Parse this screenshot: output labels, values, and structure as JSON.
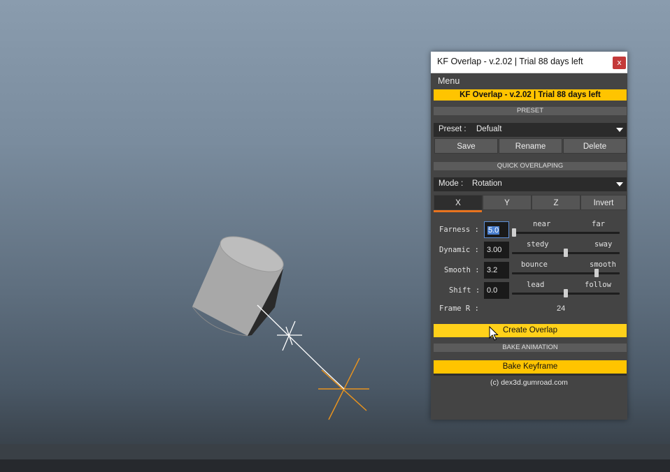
{
  "window": {
    "title": "KF Overlap  -  v.2.02  |  Trial 88 days left",
    "close_label": "x",
    "menu_label": "Menu",
    "banner": "KF Overlap  -  v.2.02  |  Trial 88 days left"
  },
  "preset": {
    "section_label": "PRESET",
    "label": "Preset :",
    "value": "Defualt",
    "buttons": [
      "Save",
      "Rename",
      "Delete"
    ]
  },
  "quick": {
    "section_label": "QUICK OVERLAPING",
    "mode_label": "Mode :",
    "mode_value": "Rotation",
    "tabs": [
      "X",
      "Y",
      "Z",
      "Invert"
    ],
    "selected_tab": "X"
  },
  "params": [
    {
      "label": "Farness :",
      "value": "5.0",
      "left": "near",
      "right": "far",
      "slider": 0.0
    },
    {
      "label": "Dynamic :",
      "value": "3.00",
      "left": "stedy",
      "right": "sway",
      "slider": 0.5
    },
    {
      "label": "Smooth :",
      "value": "3.2",
      "left": "bounce",
      "right": "smooth",
      "slider": 0.8
    },
    {
      "label": "Shift :",
      "value": "0.0",
      "left": "lead",
      "right": "follow",
      "slider": 0.5
    }
  ],
  "frame": {
    "label": "Frame R :",
    "value": "24"
  },
  "actions": {
    "create_label": "Create Overlap",
    "bake_section_label": "BAKE ANIMATION",
    "bake_label": "Bake Keyframe"
  },
  "credit": "(c) dex3d.gumroad.com",
  "colors": {
    "accent_yellow": "#ffc400",
    "tab_underline": "#e8731e",
    "close_red": "#c43a3a"
  },
  "viewport": {
    "objects": [
      "cylinder",
      "white-locator",
      "orange-locator"
    ]
  }
}
